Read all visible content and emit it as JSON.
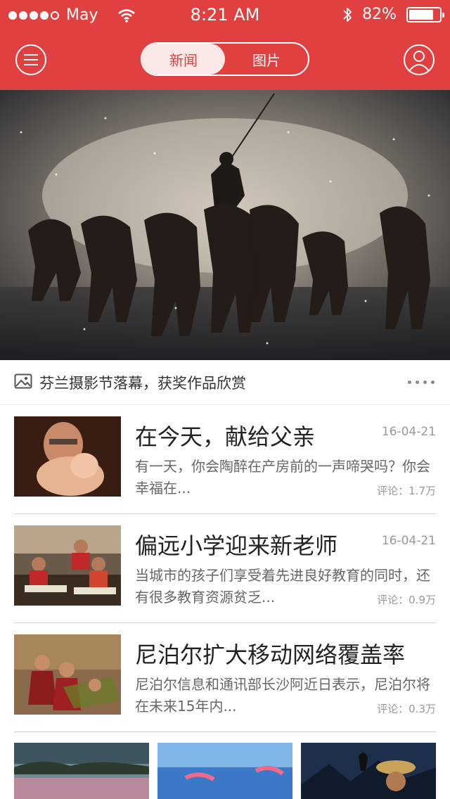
{
  "status_bar": {
    "carrier": "May",
    "time": "8:21 AM",
    "battery": "82%",
    "battery_level": 0.82
  },
  "header": {
    "tabs": [
      {
        "label": "新闻",
        "active": true
      },
      {
        "label": "图片",
        "active": false
      }
    ],
    "menu_icon": "menu-icon",
    "user_icon": "user-icon",
    "brand_color": "#e0403f"
  },
  "featured": {
    "caption": "芬兰摄影节落幕，获奖作品欣赏",
    "caption_icon": "image-icon",
    "more_icon": "more-dots-icon"
  },
  "news": [
    {
      "title": "在今天，献给父亲",
      "date": "16-04-21",
      "summary": "有一天，你会陶醉在产房前的一声啼哭吗？你会幸福在...",
      "comments": "评论：1.7万"
    },
    {
      "title": "偏远小学迎来新老师",
      "date": "16-04-21",
      "summary": "当城市的孩子们享受着先进良好教育的同时，还有很多教育资源贫乏...",
      "comments": "评论：0.9万"
    },
    {
      "title": "尼泊尔扩大移动网络覆盖率",
      "date": "",
      "summary": "尼泊尔信息和通讯部长沙阿近日表示，尼泊尔将在未来15年内...",
      "comments": "评论：0.3万"
    }
  ]
}
